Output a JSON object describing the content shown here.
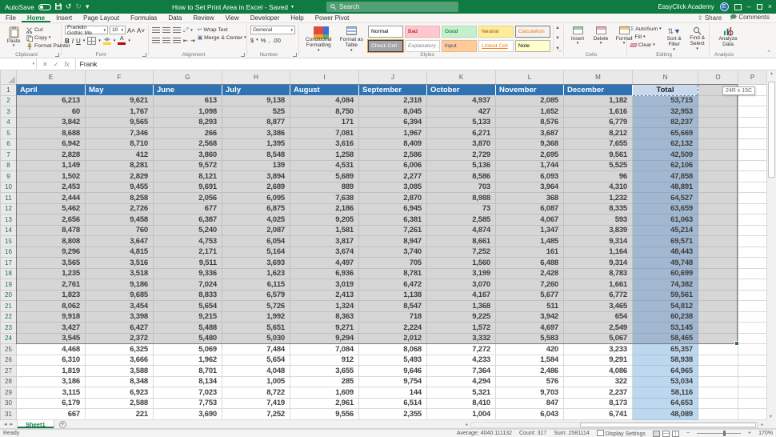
{
  "titlebar": {
    "autosave_label": "AutoSave",
    "title": "How to Set Print Area in Excel - Saved",
    "search_placeholder": "Search",
    "account_name": "EasyClick Academy",
    "brand_green": "#0f7b40"
  },
  "menubar": {
    "tabs": [
      {
        "label": "File"
      },
      {
        "label": "Home",
        "active": true
      },
      {
        "label": "Insert"
      },
      {
        "label": "Page Layout"
      },
      {
        "label": "Formulas"
      },
      {
        "label": "Data"
      },
      {
        "label": "Review"
      },
      {
        "label": "View"
      },
      {
        "label": "Developer"
      },
      {
        "label": "Help"
      },
      {
        "label": "Power Pivot"
      }
    ],
    "share": "Share",
    "comments": "Comments"
  },
  "ribbon": {
    "clipboard": {
      "label": "Clipboard",
      "paste": "Paste",
      "cut": "Cut",
      "copy": "Copy",
      "format_painter": "Format Painter"
    },
    "font": {
      "label": "Font",
      "font_name": "Franklin Gothic Me",
      "font_size": "10",
      "bold": "B",
      "italic": "I",
      "underline": "U"
    },
    "alignment": {
      "label": "Alignment",
      "wrap_text": "Wrap Text",
      "merge_center": "Merge & Center"
    },
    "number": {
      "label": "Number",
      "format": "General",
      "currency": "$",
      "percent": "%",
      "comma": ",",
      "decimals": ".00"
    },
    "styles": {
      "label": "Styles",
      "conditional": "Conditional Formatting",
      "format_table": "Format as Table",
      "gallery": [
        {
          "label": "Normal",
          "bg": "#ffffff",
          "fg": "#000000",
          "border": "#9b9b9b"
        },
        {
          "label": "Bad",
          "bg": "#ffc7ce",
          "fg": "#9c0006",
          "border": "#e8b3ba"
        },
        {
          "label": "Good",
          "bg": "#c6efce",
          "fg": "#006100",
          "border": "#b2dcba"
        },
        {
          "label": "Neutral",
          "bg": "#ffeb9c",
          "fg": "#9c5700",
          "border": "#ead789"
        },
        {
          "label": "Calculation",
          "bg": "#f2f2f2",
          "fg": "#fa7d00",
          "border": "#7f7f7f"
        },
        {
          "label": "Check Cell",
          "bg": "#a5a5a5",
          "fg": "#ffffff",
          "border": "#3f3f3f",
          "selected": true
        },
        {
          "label": "Explanatory ...",
          "bg": "#ffffff",
          "fg": "#7f7f7f",
          "border": "#d2d0ce",
          "italic": true
        },
        {
          "label": "Input",
          "bg": "#ffcc99",
          "fg": "#3f3f76",
          "border": "#e5b886"
        },
        {
          "label": "Linked Cell",
          "bg": "#ffffff",
          "fg": "#fa7d00",
          "border": "#d2d0ce"
        },
        {
          "label": "Note",
          "bg": "#ffffcc",
          "fg": "#000000",
          "border": "#b2b2b2"
        }
      ]
    },
    "cells": {
      "label": "Cells",
      "insert": "Insert",
      "delete": "Delete",
      "format": "Format"
    },
    "editing": {
      "label": "Editing",
      "autosum": "AutoSum",
      "fill": "Fill",
      "clear": "Clear",
      "sort": "Sort & Filter",
      "find": "Find & Select"
    },
    "analysis": {
      "label": "Analysis",
      "analyze": "Analyze Data"
    }
  },
  "formula_bar": {
    "name_box": "",
    "fx": "fx",
    "formula": "Frank"
  },
  "grid": {
    "columns": [
      "E",
      "F",
      "G",
      "H",
      "I",
      "J",
      "K",
      "L",
      "M",
      "N",
      "O",
      "P"
    ],
    "column_letters_of_data": [
      "E",
      "F",
      "G",
      "H",
      "I",
      "J",
      "K",
      "L",
      "M",
      "N"
    ],
    "header_row": [
      "April",
      "May",
      "June",
      "July",
      "August",
      "September",
      "October",
      "November",
      "December",
      "Total"
    ],
    "first_row_number": 1,
    "rows": [
      [
        "6,213",
        "9,621",
        "613",
        "9,138",
        "4,084",
        "2,318",
        "4,937",
        "2,085",
        "1,182",
        "53,715"
      ],
      [
        "60",
        "1,767",
        "1,098",
        "525",
        "8,750",
        "8,045",
        "427",
        "1,652",
        "1,616",
        "32,953"
      ],
      [
        "3,842",
        "9,565",
        "8,293",
        "8,877",
        "171",
        "6,394",
        "5,133",
        "8,576",
        "6,779",
        "82,237"
      ],
      [
        "8,688",
        "7,346",
        "266",
        "3,386",
        "7,081",
        "1,967",
        "6,271",
        "3,687",
        "8,212",
        "65,669"
      ],
      [
        "6,942",
        "8,710",
        "2,568",
        "1,395",
        "3,616",
        "8,409",
        "3,870",
        "9,368",
        "7,655",
        "62,132"
      ],
      [
        "2,828",
        "412",
        "3,860",
        "8,548",
        "1,258",
        "2,586",
        "2,729",
        "2,695",
        "9,561",
        "42,509"
      ],
      [
        "1,149",
        "8,281",
        "9,572",
        "139",
        "4,531",
        "6,006",
        "5,136",
        "1,744",
        "5,525",
        "62,106"
      ],
      [
        "1,502",
        "2,829",
        "8,121",
        "3,894",
        "5,689",
        "2,277",
        "8,586",
        "6,093",
        "96",
        "47,858"
      ],
      [
        "2,453",
        "9,455",
        "9,691",
        "2,689",
        "889",
        "3,085",
        "703",
        "3,964",
        "4,310",
        "48,891"
      ],
      [
        "2,444",
        "8,258",
        "2,056",
        "6,095",
        "7,638",
        "2,870",
        "8,988",
        "368",
        "1,232",
        "64,527"
      ],
      [
        "5,462",
        "2,726",
        "677",
        "6,875",
        "2,186",
        "6,945",
        "73",
        "6,087",
        "8,335",
        "63,659"
      ],
      [
        "2,656",
        "9,458",
        "6,387",
        "4,025",
        "9,205",
        "6,381",
        "2,585",
        "4,067",
        "593",
        "61,063"
      ],
      [
        "8,478",
        "760",
        "5,240",
        "2,087",
        "1,581",
        "7,261",
        "4,874",
        "1,347",
        "3,839",
        "45,214"
      ],
      [
        "8,808",
        "3,647",
        "4,753",
        "6,054",
        "3,817",
        "8,947",
        "8,661",
        "1,485",
        "9,314",
        "69,571"
      ],
      [
        "9,296",
        "4,815",
        "2,171",
        "5,164",
        "3,674",
        "3,740",
        "7,252",
        "161",
        "1,164",
        "48,443"
      ],
      [
        "3,565",
        "3,516",
        "9,511",
        "3,693",
        "4,497",
        "705",
        "1,560",
        "6,488",
        "9,314",
        "49,748"
      ],
      [
        "1,235",
        "3,518",
        "9,336",
        "1,623",
        "6,936",
        "8,781",
        "3,199",
        "2,428",
        "8,783",
        "60,699"
      ],
      [
        "2,761",
        "9,186",
        "7,024",
        "6,115",
        "3,019",
        "6,472",
        "3,070",
        "7,260",
        "1,661",
        "74,382"
      ],
      [
        "1,823",
        "9,685",
        "8,833",
        "6,579",
        "2,413",
        "1,138",
        "4,167",
        "5,677",
        "6,772",
        "59,561"
      ],
      [
        "8,062",
        "3,454",
        "5,654",
        "5,726",
        "1,324",
        "8,547",
        "1,368",
        "511",
        "3,465",
        "54,812"
      ],
      [
        "9,918",
        "3,398",
        "9,215",
        "1,992",
        "8,363",
        "718",
        "9,225",
        "3,942",
        "654",
        "60,238"
      ],
      [
        "3,427",
        "6,427",
        "5,488",
        "5,651",
        "9,271",
        "2,224",
        "1,572",
        "4,697",
        "2,549",
        "53,145"
      ],
      [
        "3,545",
        "2,372",
        "5,480",
        "5,030",
        "9,294",
        "2,012",
        "3,332",
        "5,583",
        "5,067",
        "58,465"
      ],
      [
        "4,468",
        "6,325",
        "5,069",
        "7,484",
        "7,084",
        "8,068",
        "7,272",
        "420",
        "3,233",
        "65,357"
      ],
      [
        "6,310",
        "3,666",
        "1,962",
        "5,654",
        "912",
        "5,493",
        "4,233",
        "1,584",
        "9,291",
        "58,938"
      ],
      [
        "1,819",
        "3,588",
        "8,701",
        "4,048",
        "3,655",
        "9,646",
        "7,364",
        "2,486",
        "4,086",
        "64,965"
      ],
      [
        "3,186",
        "8,348",
        "8,134",
        "1,005",
        "285",
        "9,754",
        "4,294",
        "576",
        "322",
        "53,034"
      ],
      [
        "3,115",
        "6,923",
        "7,023",
        "8,722",
        "1,609",
        "144",
        "5,321",
        "9,703",
        "2,237",
        "58,116"
      ],
      [
        "6,179",
        "2,588",
        "7,753",
        "7,419",
        "2,961",
        "6,514",
        "8,410",
        "847",
        "8,173",
        "64,653"
      ],
      [
        "667",
        "221",
        "3,690",
        "7,252",
        "9,556",
        "2,355",
        "1,004",
        "6,043",
        "6,741",
        "48,089"
      ]
    ],
    "selection": {
      "tooltip": "24R x 15C",
      "rows_selected_through": 24,
      "last_selected_column": "O",
      "total_column": "N"
    },
    "colors": {
      "month_header_fill": "#2e74b5",
      "month_header_text": "#ffffff",
      "total_fill": "#bdd7ee",
      "total_fill_selected": "#a2b7d0",
      "selection_gray": "#d6d6d6",
      "active_total_cell": "#c9d8ea"
    }
  },
  "sheet_tabs": {
    "tabs": [
      {
        "label": "Sheet1",
        "active": true
      }
    ]
  },
  "status_bar": {
    "mode": "Ready",
    "average": "Average: 4040.111132",
    "count": "Count: 317",
    "sum": "Sum: 2581114",
    "display_settings": "Display Settings",
    "zoom": "170%"
  }
}
